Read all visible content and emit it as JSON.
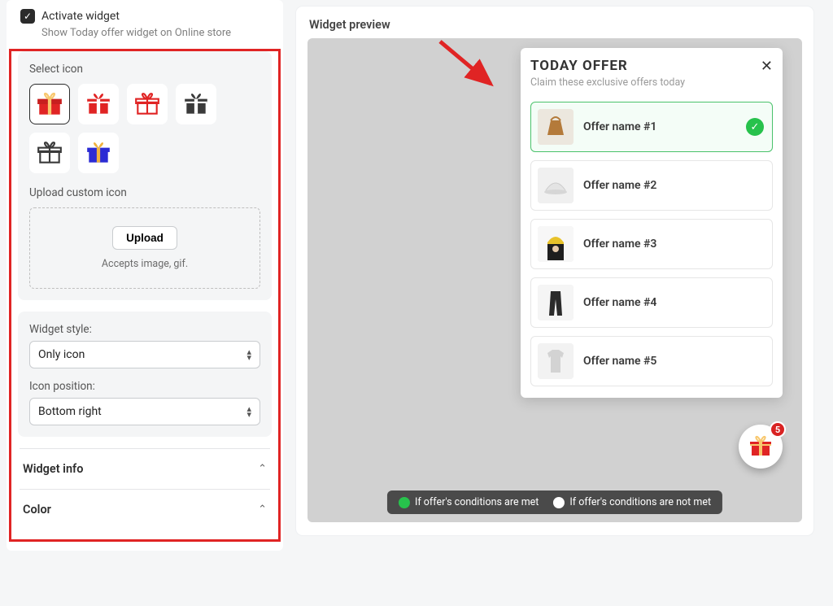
{
  "left": {
    "activate_label": "Activate widget",
    "activate_desc": "Show Today offer widget on Online store",
    "select_icon_label": "Select icon",
    "upload_label": "Upload custom icon",
    "upload_button": "Upload",
    "upload_help": "Accepts image, gif.",
    "widget_style_label": "Widget style:",
    "widget_style_value": "Only icon",
    "icon_position_label": "Icon position:",
    "icon_position_value": "Bottom right",
    "accordion_widget_info": "Widget info",
    "accordion_color": "Color"
  },
  "preview": {
    "heading": "Widget preview",
    "modal_title": "TODAY OFFER",
    "modal_subtitle": "Claim these exclusive offers today",
    "offers": [
      {
        "label": "Offer name #1"
      },
      {
        "label": "Offer name #2"
      },
      {
        "label": "Offer name #3"
      },
      {
        "label": "Offer name #4"
      },
      {
        "label": "Offer name #5"
      }
    ],
    "badge_count": "5",
    "legend_met": "If offer's conditions are met",
    "legend_not_met": "If offer's conditions are not met"
  },
  "icons": [
    {
      "name": "gift-flat-red"
    },
    {
      "name": "gift-solid-red"
    },
    {
      "name": "gift-outline-red"
    },
    {
      "name": "gift-solid-dark"
    },
    {
      "name": "gift-outline-dark"
    },
    {
      "name": "gift-solid-blue"
    }
  ]
}
